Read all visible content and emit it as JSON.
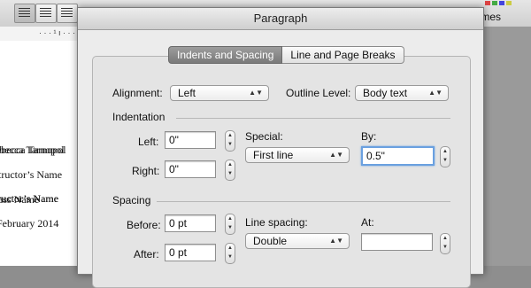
{
  "background": {
    "styles_label": "mes",
    "ruler_text": "· · · ¹ ı · · ·",
    "document_lines": [
      "ebecca Tarnopol",
      "tructor’s Name",
      "ass Name",
      "February 2014"
    ]
  },
  "dialog": {
    "title": "Paragraph",
    "tabs": [
      {
        "label": "Indents and Spacing",
        "active": true
      },
      {
        "label": "Line and Page Breaks",
        "active": false
      }
    ],
    "general": {
      "alignment_label": "Alignment:",
      "alignment_value": "Left",
      "outline_label": "Outline Level:",
      "outline_value": "Body text"
    },
    "indentation": {
      "section_label": "Indentation",
      "left_label": "Left:",
      "left_value": "0\"",
      "right_label": "Right:",
      "right_value": "0\"",
      "special_label": "Special:",
      "special_value": "First line",
      "by_label": "By:",
      "by_value": "0.5\""
    },
    "spacing": {
      "section_label": "Spacing",
      "before_label": "Before:",
      "before_value": "0 pt",
      "after_label": "After:",
      "after_value": "0 pt",
      "line_spacing_label": "Line spacing:",
      "line_spacing_value": "Double",
      "at_label": "At:",
      "at_value": ""
    }
  }
}
